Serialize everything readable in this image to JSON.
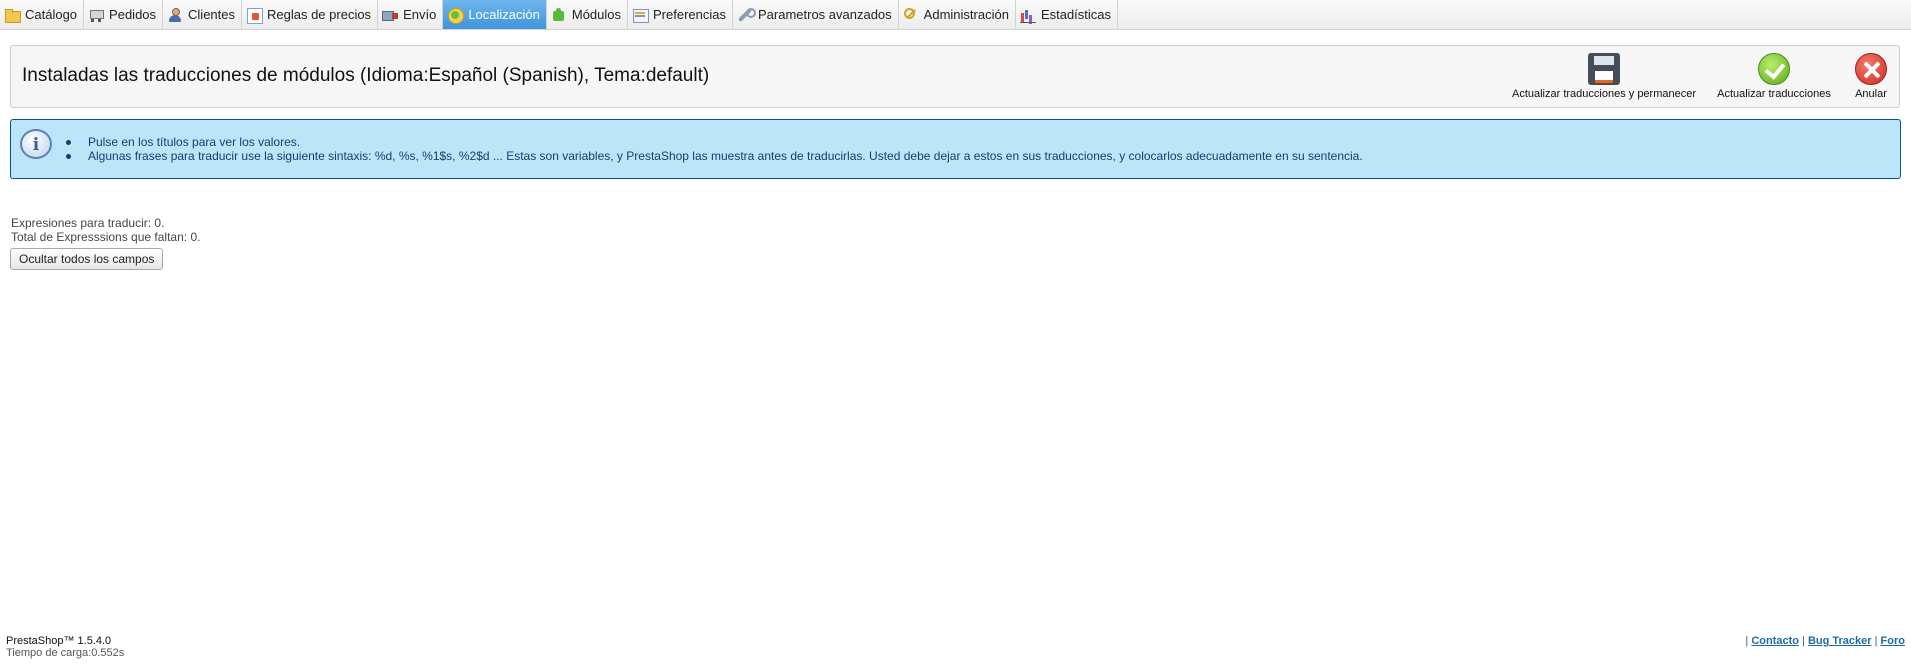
{
  "menu": {
    "tabs": [
      {
        "label": "Catálogo",
        "icon": "folder-icon"
      },
      {
        "label": "Pedidos",
        "icon": "cart-icon"
      },
      {
        "label": "Clientes",
        "icon": "user-icon"
      },
      {
        "label": "Reglas de precios",
        "icon": "price-rules-icon"
      },
      {
        "label": "Envío",
        "icon": "truck-icon"
      },
      {
        "label": "Localización",
        "icon": "globe-icon",
        "active": true
      },
      {
        "label": "Módulos",
        "icon": "puzzle-icon"
      },
      {
        "label": "Preferencias",
        "icon": "preferences-icon"
      },
      {
        "label": "Parametros avanzados",
        "icon": "wrench-icon"
      },
      {
        "label": "Administración",
        "icon": "key-icon"
      },
      {
        "label": "Estadísticas",
        "icon": "chart-icon"
      }
    ],
    "active_color": "#4a9fe0"
  },
  "toolbar": {
    "title": "Instaladas las traducciones de módulos (Idioma:Español (Spanish), Tema:default)",
    "save_stay_label": "Actualizar traducciones y permanecer",
    "save_stay_icon": "floppy-disk-icon",
    "update_label": "Actualizar traducciones",
    "update_icon": "check-circle-icon",
    "cancel_label": "Anular",
    "cancel_icon": "cancel-circle-icon"
  },
  "info": {
    "icon": "info-icon",
    "items": [
      "Pulse en los títulos para ver los valores.",
      "Algunas frases para traducir use la siguiente sintaxis: %d, %s, %1$s, %2$d ... Estas son variables, y PrestaShop las muestra antes de traducirlas. Usted debe dejar a estos en sus traducciones, y colocarlos adecuadamente en su sentencia."
    ],
    "background": "#bde5f8",
    "border": "#00529b"
  },
  "counts": {
    "to_translate": "Expresiones para traducir: 0.",
    "missing": "Total de Expresssions que faltan: 0."
  },
  "hide_button_label": "Ocultar todos los campos",
  "footer": {
    "version": "PrestaShop™ 1.5.4.0",
    "load_time": "Tiempo de carga:0.552s",
    "links": [
      "Contacto",
      "Bug Tracker",
      "Foro"
    ],
    "link_color": "#2269a8"
  }
}
